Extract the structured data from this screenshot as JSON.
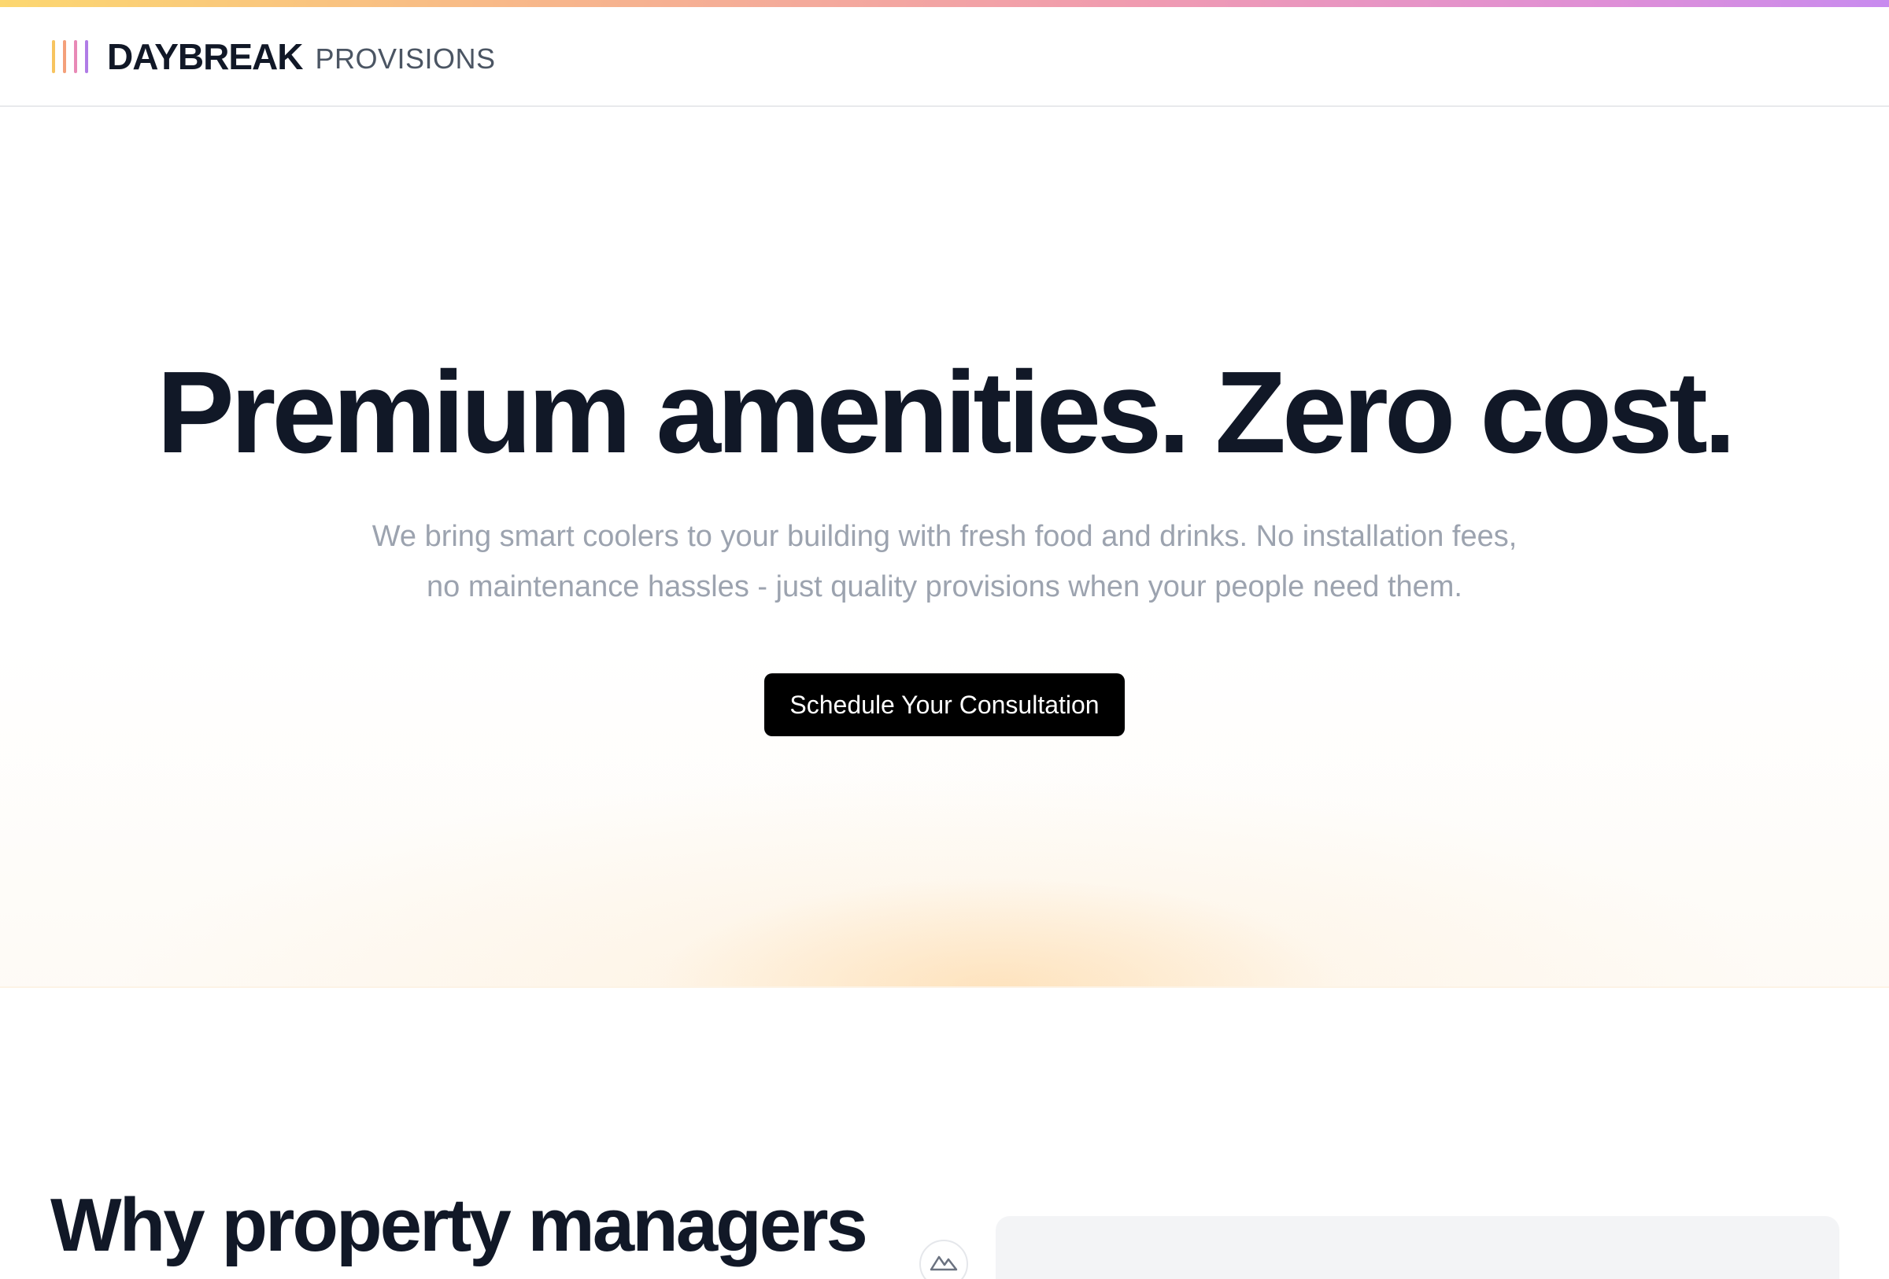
{
  "brand": {
    "name": "DAYBREAK",
    "tagline": "PROVISIONS",
    "bar_colors": [
      "#f7c45f",
      "#f4a07a",
      "#e889b6",
      "#b07ce6"
    ]
  },
  "hero": {
    "title": "Premium amenities. Zero cost.",
    "subtitle": "We bring smart coolers to your building with fresh food and drinks. No installation fees, no maintenance hassles - just quality provisions when your people need them.",
    "cta_label": "Schedule Your Consultation"
  },
  "why": {
    "heading": "Why property managers"
  },
  "icons": {
    "media_badge": "mountain-icon"
  },
  "colors": {
    "text": "#111827",
    "muted": "#9ca3af",
    "cta_bg": "#000000",
    "accent_gradient": [
      "#fcd770",
      "#f09bb0",
      "#c88bef"
    ]
  }
}
